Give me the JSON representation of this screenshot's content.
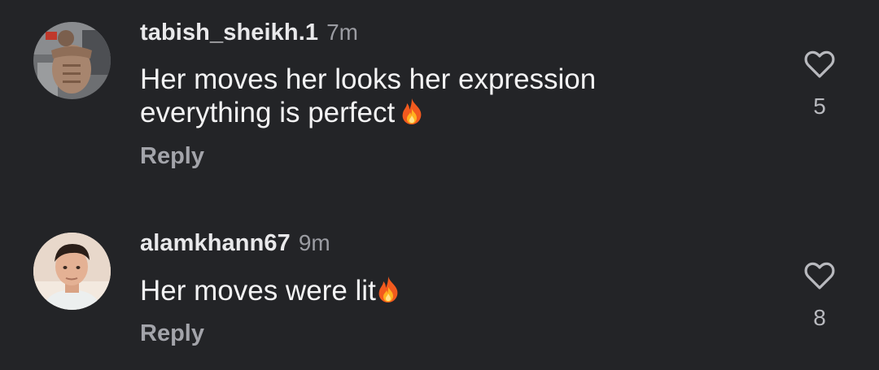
{
  "comments": [
    {
      "username": "tabish_sheikh.1",
      "time": "7m",
      "text": "Her moves her looks her expression everything is perfect",
      "emoji": "fire-emoji",
      "reply_label": "Reply",
      "like_icon": "heart-outline-icon",
      "likes": "5"
    },
    {
      "username": "alamkhann67",
      "time": "9m",
      "text": "Her moves were lit",
      "emoji": "fire-emoji",
      "reply_label": "Reply",
      "like_icon": "heart-outline-icon",
      "likes": "8"
    }
  ],
  "colors": {
    "background": "#232427",
    "text": "#f3f3f4",
    "muted": "#9b9ca2",
    "reply": "#a3a4aa"
  }
}
